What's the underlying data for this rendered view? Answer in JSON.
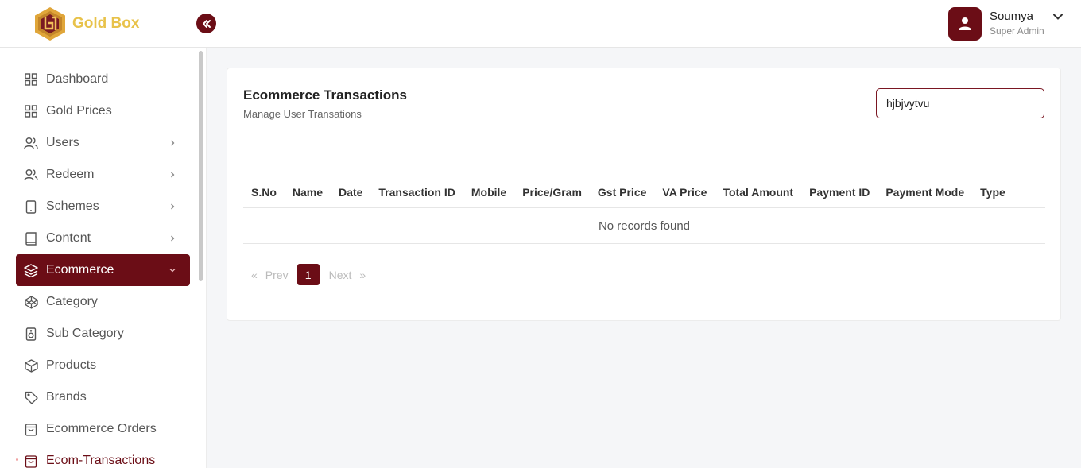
{
  "brand": {
    "name": "Gold Box"
  },
  "user": {
    "name": "Soumya",
    "role": "Super Admin"
  },
  "sidebar": {
    "items": [
      {
        "label": "Dashboard",
        "icon": "grid-icon",
        "has_chevron": false
      },
      {
        "label": "Gold Prices",
        "icon": "grid-icon",
        "has_chevron": false
      },
      {
        "label": "Users",
        "icon": "users-icon",
        "has_chevron": true
      },
      {
        "label": "Redeem",
        "icon": "users-icon",
        "has_chevron": true
      },
      {
        "label": "Schemes",
        "icon": "tablet-icon",
        "has_chevron": true
      },
      {
        "label": "Content",
        "icon": "book-icon",
        "has_chevron": true
      },
      {
        "label": "Ecommerce",
        "icon": "layers-icon",
        "has_chevron": true,
        "state": "expanded"
      },
      {
        "label": "Category",
        "icon": "codepen-icon",
        "has_chevron": false
      },
      {
        "label": "Sub Category",
        "icon": "speaker-icon",
        "has_chevron": false
      },
      {
        "label": "Products",
        "icon": "box-icon",
        "has_chevron": false
      },
      {
        "label": "Brands",
        "icon": "tag-icon",
        "has_chevron": false
      },
      {
        "label": "Ecommerce Orders",
        "icon": "shopping-bag-icon",
        "has_chevron": false
      },
      {
        "label": "Ecom-Transactions",
        "icon": "shopping-bag-icon",
        "has_chevron": false,
        "state": "current"
      }
    ]
  },
  "main": {
    "title": "Ecommerce Transactions",
    "subtitle": "Manage User Transations",
    "search": {
      "value": "hjbjvytvu"
    },
    "table": {
      "columns": [
        "S.No",
        "Name",
        "Date",
        "Transaction ID",
        "Mobile",
        "Price/Gram",
        "Gst Price",
        "VA Price",
        "Total Amount",
        "Payment ID",
        "Payment Mode",
        "Type"
      ],
      "empty_message": "No records found"
    },
    "pagination": {
      "prev_label": "Prev",
      "next_label": "Next",
      "first_symbol": "«",
      "last_symbol": "»",
      "current_page": "1"
    }
  },
  "colors": {
    "primary": "#6b0d16",
    "brand_gold": "#e8c24a"
  }
}
